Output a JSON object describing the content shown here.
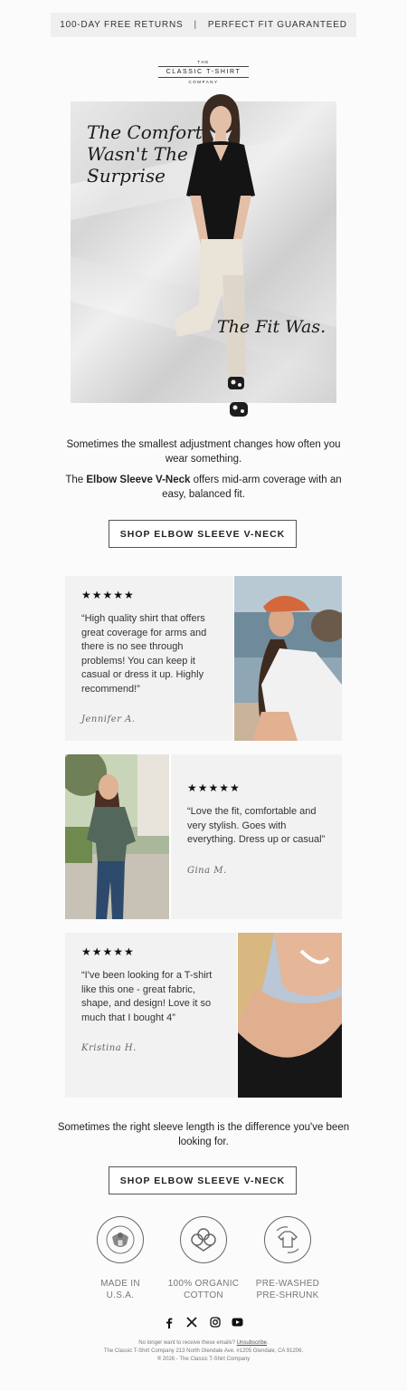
{
  "topbar": {
    "left": "100-DAY FREE RETURNS",
    "sep": "|",
    "right": "PERFECT FIT GUARANTEED"
  },
  "logo": {
    "top": "THE",
    "main": "CLASSIC T-SHIRT",
    "bottom": "COMPANY"
  },
  "hero": {
    "title": "The Comfort\nWasn't The\nSurprise",
    "subtitle": "The Fit Was."
  },
  "intro": {
    "line1": "Sometimes the smallest adjustment changes how often you wear something.",
    "line2_pre": "The ",
    "line2_bold": "Elbow Sleeve V-Neck",
    "line2_post": " offers mid-arm coverage with an easy, balanced fit."
  },
  "cta": {
    "label": "SHOP ELBOW SLEEVE V-NECK"
  },
  "reviews": [
    {
      "stars": "★★★★★",
      "quote": "“High quality shirt that offers great coverage for arms and there is no see through problems! You can keep it casual or dress it up. Highly recommend!”",
      "name": "Jennifer A."
    },
    {
      "stars": "★★★★★",
      "quote": "“Love the fit, comfortable and very stylish. Goes with everything. Dress up or casual”",
      "name": "Gina M."
    },
    {
      "stars": "★★★★★",
      "quote": "“I've been looking for a T-shirt like this one - great fabric, shape, and design! Love it so much that I bought 4”",
      "name": "Kristina H."
    }
  ],
  "outro": "Sometimes the right sleeve length is the difference you've been looking for.",
  "badges": [
    {
      "icon": "usa-seal-icon",
      "label1": "MADE IN",
      "label2": "U.S.A."
    },
    {
      "icon": "cotton-icon",
      "label1": "100% ORGANIC",
      "label2": "COTTON"
    },
    {
      "icon": "preshrunk-shirt-icon",
      "label1": "PRE-WASHED",
      "label2": "PRE-SHRUNK"
    }
  ],
  "social": [
    "facebook-icon",
    "x-icon",
    "instagram-icon",
    "youtube-icon"
  ],
  "footer": {
    "unsub_pre": "No longer want to receive these emails? ",
    "unsub_link": "Unsubscribe",
    "unsub_post": ".",
    "address": "The Classic T-Shirt Company 213 North Glendale Ave. #1205 Glendale, CA 91206.",
    "copyright": "® 2026 - The Classic T-Shirt Company"
  },
  "colors": {
    "panel": "#f2f2f2",
    "topbar": "#efefef",
    "text": "#222222",
    "muted": "#777777"
  }
}
